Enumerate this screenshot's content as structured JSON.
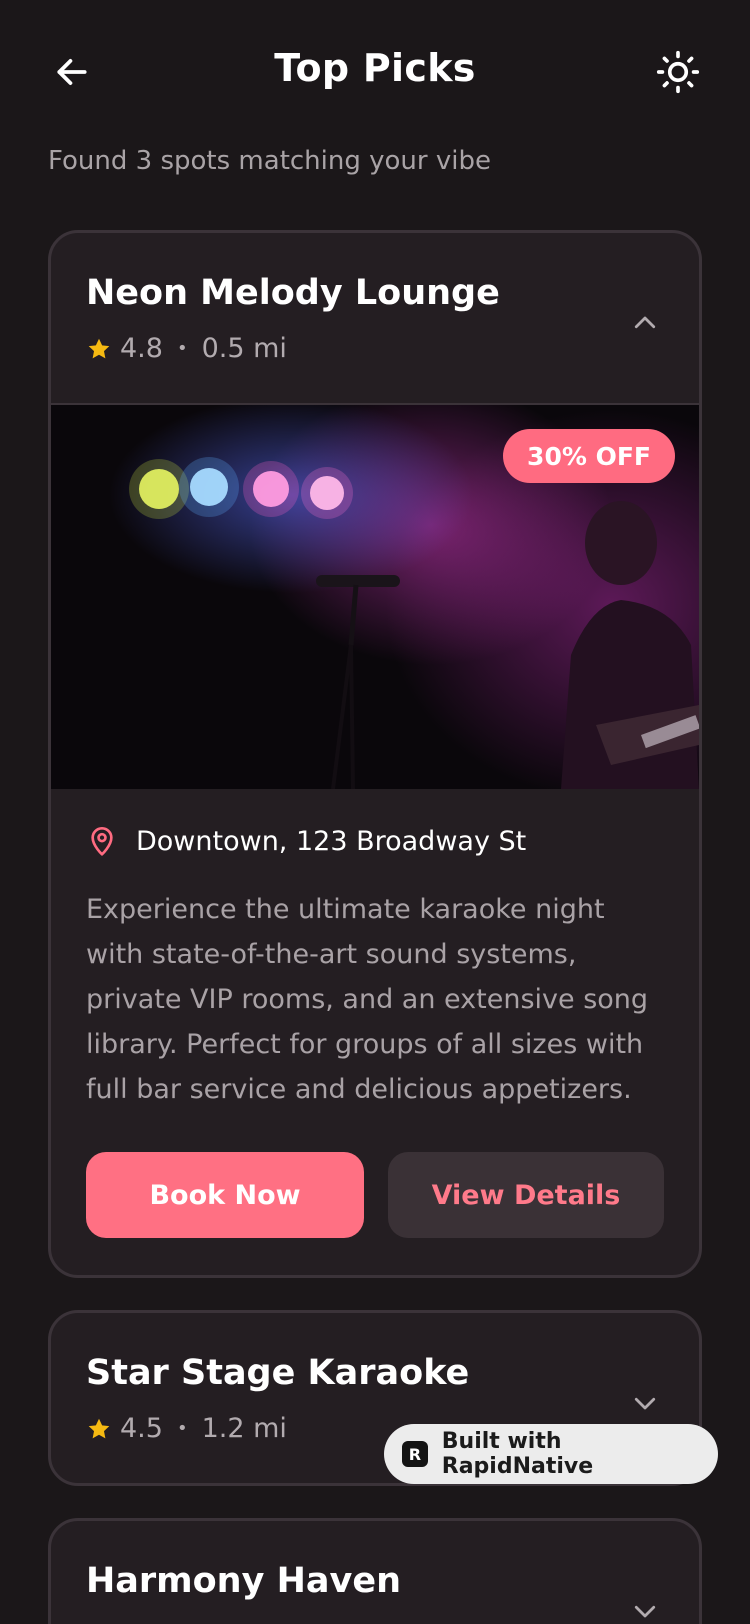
{
  "header": {
    "title": "Top Picks",
    "back_icon": "arrow-left-icon",
    "theme_icon": "sun-icon"
  },
  "subtitle": "Found 3 spots matching your vibe",
  "colors": {
    "background": "#1b1719",
    "card": "#241e22",
    "accent": "#ff7083",
    "star": "#f5b912"
  },
  "cards": [
    {
      "name": "Neon Melody Lounge",
      "rating": "4.8",
      "separator": "•",
      "distance": "0.5 mi",
      "expanded": true,
      "chevron_icon": "chevron-up-icon",
      "badge": "30% OFF",
      "address": "Downtown, 123 Broadway St",
      "description": "Experience the ultimate karaoke night with state-of-the-art sound systems, private VIP rooms, and an extensive song library. Perfect for groups of all sizes with full bar service and delicious appetizers.",
      "primary_action": "Book Now",
      "secondary_action": "View Details"
    },
    {
      "name": "Star Stage Karaoke",
      "rating": "4.5",
      "separator": "•",
      "distance": "1.2 mi",
      "expanded": false,
      "chevron_icon": "chevron-down-icon"
    },
    {
      "name": "Harmony Haven",
      "expanded": false,
      "chevron_icon": "chevron-down-icon"
    }
  ],
  "rapidnative_badge": {
    "logo_letter": "R",
    "label": "Built with RapidNative"
  }
}
